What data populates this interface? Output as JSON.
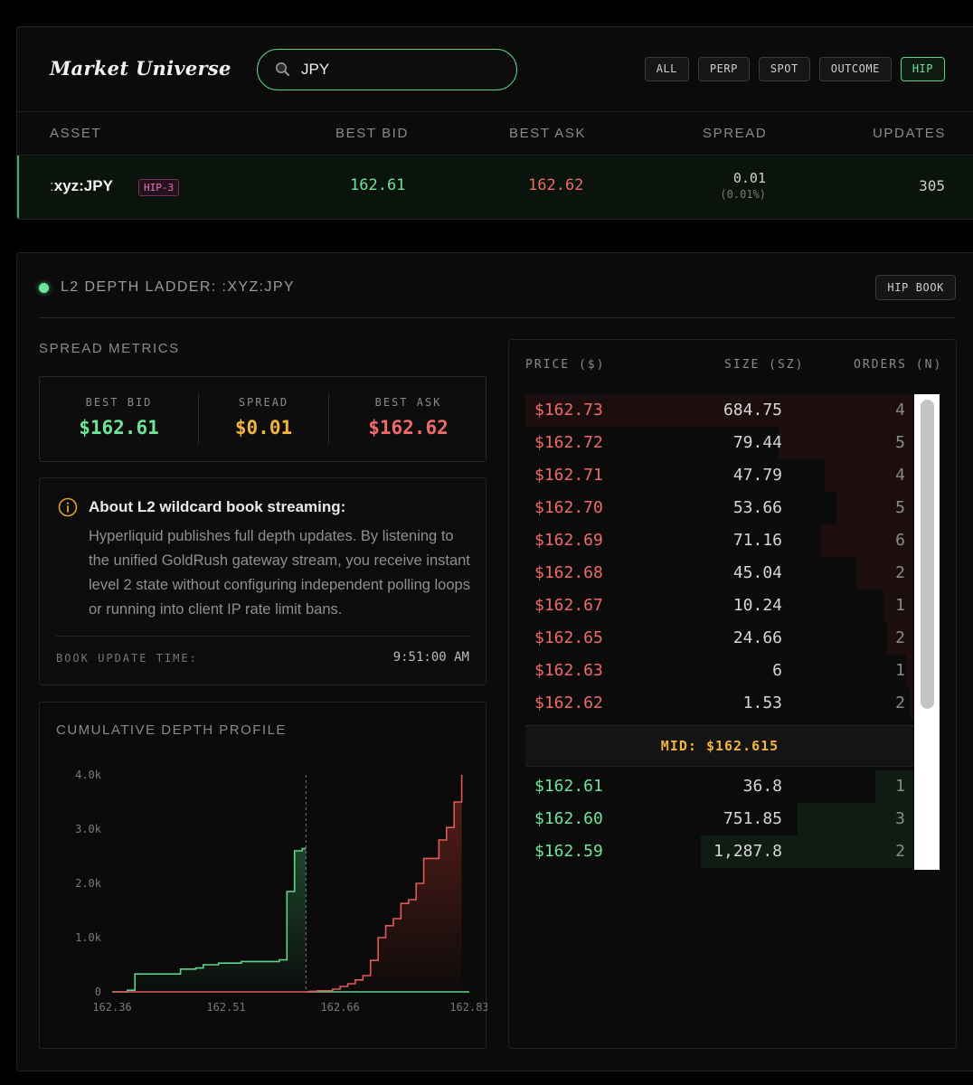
{
  "header": {
    "title": "Market Universe",
    "search": {
      "value": "JPY",
      "placeholder": ""
    },
    "filters": [
      "ALL",
      "PERP",
      "SPOT",
      "OUTCOME",
      "HIP"
    ],
    "active_filter": "HIP"
  },
  "table": {
    "columns": [
      "ASSET",
      "BEST BID",
      "BEST ASK",
      "SPREAD",
      "UPDATES"
    ],
    "rows": [
      {
        "prefix": ":",
        "asset": "xyz:JPY",
        "badge": "HIP-3",
        "best_bid": "162.61",
        "best_ask": "162.62",
        "spread": "0.01",
        "spread_pct": "(0.01%)",
        "updates": "305"
      }
    ]
  },
  "depth": {
    "title": "L2 DEPTH LADDER: :XYZ:JPY",
    "book_button": "HIP BOOK",
    "spread_metrics_label": "SPREAD METRICS",
    "metrics": {
      "best_bid_label": "BEST BID",
      "best_bid": "$162.61",
      "spread_label": "SPREAD",
      "spread": "$0.01",
      "best_ask_label": "BEST ASK",
      "best_ask": "$162.62"
    },
    "info": {
      "title": "About L2 wildcard book streaming:",
      "body": "Hyperliquid publishes full depth updates. By listening to the unified GoldRush gateway stream, you receive instant level 2 state without configuring independent polling loops or running into client IP rate limit bans.",
      "update_label": "BOOK UPDATE TIME:",
      "update_time": "9:51:00 AM"
    },
    "profile": {
      "title": "CUMULATIVE DEPTH PROFILE"
    },
    "ladder": {
      "headers": [
        "PRICE ($)",
        "SIZE (SZ)",
        "ORDERS (N)"
      ],
      "asks": [
        {
          "price": "$162.73",
          "size": "684.75",
          "orders": "4",
          "depth": 1.0
        },
        {
          "price": "$162.72",
          "size": "79.44",
          "orders": "5",
          "depth": 0.35
        },
        {
          "price": "$162.71",
          "size": "47.79",
          "orders": "4",
          "depth": 0.23
        },
        {
          "price": "$162.70",
          "size": "53.66",
          "orders": "5",
          "depth": 0.2
        },
        {
          "price": "$162.69",
          "size": "71.16",
          "orders": "6",
          "depth": 0.24
        },
        {
          "price": "$162.68",
          "size": "45.04",
          "orders": "2",
          "depth": 0.15
        },
        {
          "price": "$162.67",
          "size": "10.24",
          "orders": "1",
          "depth": 0.08
        },
        {
          "price": "$162.65",
          "size": "24.66",
          "orders": "2",
          "depth": 0.07
        },
        {
          "price": "$162.63",
          "size": "6",
          "orders": "1",
          "depth": 0.02
        },
        {
          "price": "$162.62",
          "size": "1.53",
          "orders": "2",
          "depth": 0.01
        }
      ],
      "mid": "MID: $162.615",
      "bids": [
        {
          "price": "$162.61",
          "size": "36.8",
          "orders": "1",
          "depth": 0.1
        },
        {
          "price": "$162.60",
          "size": "751.85",
          "orders": "3",
          "depth": 0.3
        },
        {
          "price": "$162.59",
          "size": "1,287.8",
          "orders": "2",
          "depth": 0.55
        }
      ]
    }
  },
  "chart_data": {
    "type": "area",
    "title": "CUMULATIVE DEPTH PROFILE",
    "xlabel": "",
    "ylabel": "",
    "xlim": [
      162.36,
      162.83
    ],
    "ylim": [
      0,
      4000
    ],
    "yticks": [
      "0",
      "1.0k",
      "2.0k",
      "3.0k",
      "4.0k"
    ],
    "xticks": [
      "162.36",
      "162.51",
      "162.66",
      "162.83"
    ],
    "mid": 162.615,
    "grid": false,
    "colors": {
      "bids": "#5fd38a",
      "asks": "#e05a5a",
      "mid_line": "#777777"
    },
    "series": [
      {
        "side": "bids",
        "x": [
          162.36,
          162.38,
          162.39,
          162.45,
          162.47,
          162.48,
          162.5,
          162.53,
          162.58,
          162.59,
          162.6,
          162.61,
          162.615
        ],
        "y": [
          0,
          30,
          330,
          420,
          440,
          500,
          530,
          560,
          590,
          1850,
          2600,
          2640,
          2640
        ]
      },
      {
        "side": "asks",
        "x": [
          162.615,
          162.62,
          162.63,
          162.65,
          162.66,
          162.67,
          162.68,
          162.69,
          162.7,
          162.71,
          162.72,
          162.73,
          162.74,
          162.75,
          162.76,
          162.77,
          162.78,
          162.79,
          162.8,
          162.81,
          162.82
        ],
        "y": [
          0,
          10,
          20,
          50,
          100,
          150,
          220,
          300,
          580,
          1000,
          1220,
          1350,
          1630,
          1700,
          2000,
          2460,
          2460,
          2800,
          3030,
          3500,
          4000
        ]
      }
    ]
  }
}
